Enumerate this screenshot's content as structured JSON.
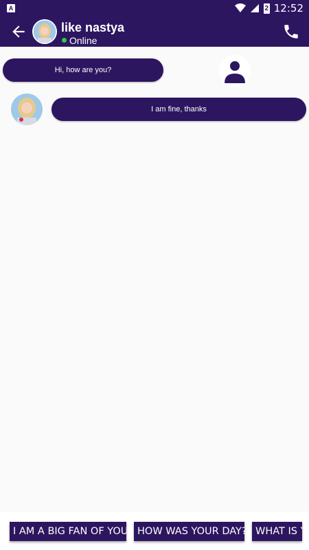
{
  "status_bar": {
    "left_icon": "A",
    "time": "12:52",
    "battery_level": "2",
    "icons": [
      "wifi-icon",
      "signal-icon",
      "battery-icon"
    ]
  },
  "header": {
    "name": "like nastya",
    "status": "Online",
    "back_icon": "arrow-left-icon",
    "call_icon": "phone-icon"
  },
  "messages": [
    {
      "from": "me",
      "text": "Hi, how are you?"
    },
    {
      "from": "contact",
      "text": "I am fine, thanks"
    }
  ],
  "quick_replies": [
    "I AM A BIG FAN OF YOU",
    "HOW WAS YOUR DAY?",
    "WHAT IS YOUR"
  ],
  "colors": {
    "primary": "#2d1660",
    "background": "#fafafa",
    "online": "#2ecc40",
    "text_light": "#ffffff"
  }
}
